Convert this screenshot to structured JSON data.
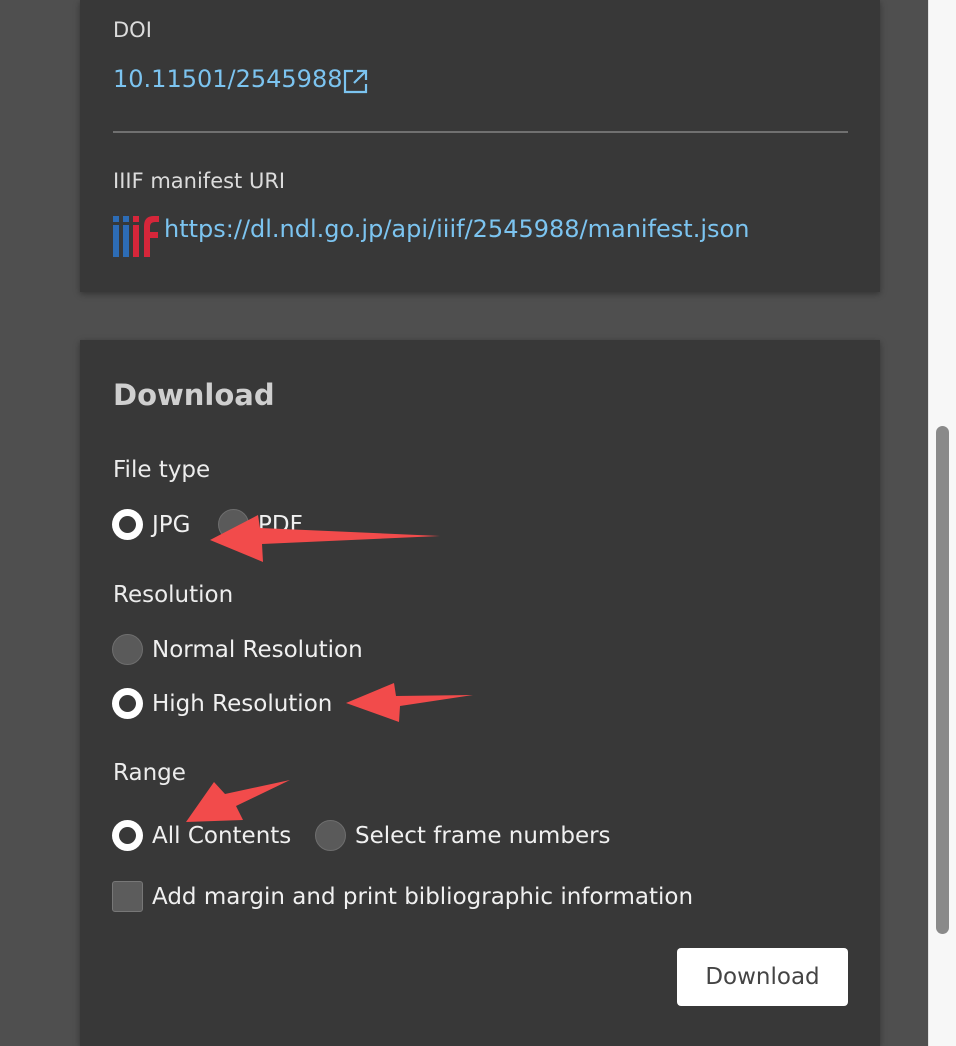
{
  "info": {
    "doi_label": "DOI",
    "doi_value": "10.11501/2545988",
    "iiif_label": "IIIF manifest URI",
    "iiif_value": "https://dl.ndl.go.jp/api/iiif/2545988/manifest.json"
  },
  "download": {
    "title": "Download",
    "file_type": {
      "label": "File type",
      "options": [
        "JPG",
        "PDF"
      ],
      "selected": "JPG"
    },
    "resolution": {
      "label": "Resolution",
      "options": [
        "Normal Resolution",
        "High Resolution"
      ],
      "selected": "High Resolution"
    },
    "range": {
      "label": "Range",
      "options": [
        "All Contents",
        "Select frame numbers"
      ],
      "selected": "All Contents"
    },
    "margin_checkbox": {
      "label": "Add margin and print bibliographic information",
      "checked": false
    },
    "button_label": "Download"
  },
  "colors": {
    "link": "#7cc4f0",
    "card_bg": "#383838",
    "page_bg": "#4f4f4f",
    "annotation_arrow": "#f24b4b"
  },
  "icons": [
    "external-link-icon",
    "iiif-logo-icon"
  ]
}
